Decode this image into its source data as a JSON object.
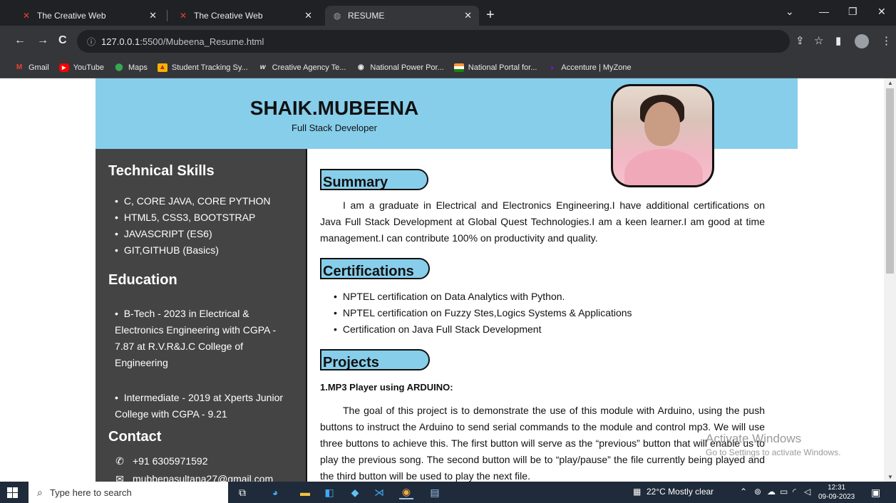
{
  "browser": {
    "tabs": [
      {
        "title": "The Creative Web",
        "active": false
      },
      {
        "title": "The Creative Web",
        "active": false
      },
      {
        "title": "RESUME",
        "active": true
      }
    ],
    "new_tab": "+",
    "url_host": "127.0.0.1",
    "url_rest": ":5500/Mubeena_Resume.html",
    "bookmarks": [
      {
        "label": "Gmail",
        "icon": "gmail-icon",
        "color": "#ea4335"
      },
      {
        "label": "YouTube",
        "icon": "youtube-icon",
        "color": "#ff0000"
      },
      {
        "label": "Maps",
        "icon": "maps-icon",
        "color": "#34a853"
      },
      {
        "label": "Student Tracking Sy...",
        "icon": "student-tracking-icon",
        "color": "#f4b400"
      },
      {
        "label": "Creative Agency Te...",
        "icon": "creative-agency-icon",
        "color": "#ffffff"
      },
      {
        "label": "National Power Por...",
        "icon": "national-power-icon",
        "color": "#ffffff"
      },
      {
        "label": "National Portal for...",
        "icon": "national-portal-icon",
        "color": "#ff9933"
      },
      {
        "label": "Accenture | MyZone",
        "icon": "accenture-icon",
        "color": "#a100ff"
      }
    ]
  },
  "resume": {
    "name": "SHAIK.MUBEENA",
    "role": "Full Stack Developer",
    "colors": {
      "accent": "#87ceeb",
      "sidebar": "#444444"
    },
    "sidebar": {
      "skills_heading": "Technical Skills",
      "skills": [
        "C, CORE JAVA, CORE PYTHON",
        "HTML5, CSS3, BOOTSTRAP",
        "JAVASCRIPT (ES6)",
        "GIT,GITHUB (Basics)"
      ],
      "education_heading": "Education",
      "education": [
        "B-Tech - 2023 in Electrical & Electronics Engineering with CGPA - 7.87 at R.V.R&J.C College of Engineering",
        "Intermediate - 2019 at Xperts Junior College with CGPA - 9.21"
      ],
      "contact_heading": "Contact",
      "phone": "+91 6305971592",
      "email": "mubbenasultana27@gmail.com"
    },
    "summary_heading": "Summary",
    "summary": "I am a graduate in Electrical and Electronics Engineering.I have additional certifications on Java Full Stack Development at Global Quest Technologies.I am a keen learner.I am good at time management.I can contribute 100% on productivity and quality.",
    "certifications_heading": "Certifications",
    "certifications": [
      "NPTEL certification on Data Analytics with Python.",
      "NPTEL certification on Fuzzy Stes,Logics Systems & Applications",
      "Certification on Java Full Stack Development"
    ],
    "projects_heading": "Projects",
    "project1_title": "1.MP3 Player using ARDUINO:",
    "project1_desc": "The goal of this project is to demonstrate the use of this module with Arduino, using the push buttons to instruct the Arduino to send serial commands to the module and control mp3. We will use three buttons to achieve this. The first button will serve as the “previous” button that will enable us to play the previous song. The second button will be to “play/pause” the file currently being played and the third button will be used to play the next file."
  },
  "watermark": {
    "line1": "Activate Windows",
    "line2": "Go to Settings to activate Windows."
  },
  "taskbar": {
    "search_placeholder": "Type here to search",
    "weather": "22°C  Mostly clear",
    "time": "12:31",
    "date": "09-09-2023"
  }
}
